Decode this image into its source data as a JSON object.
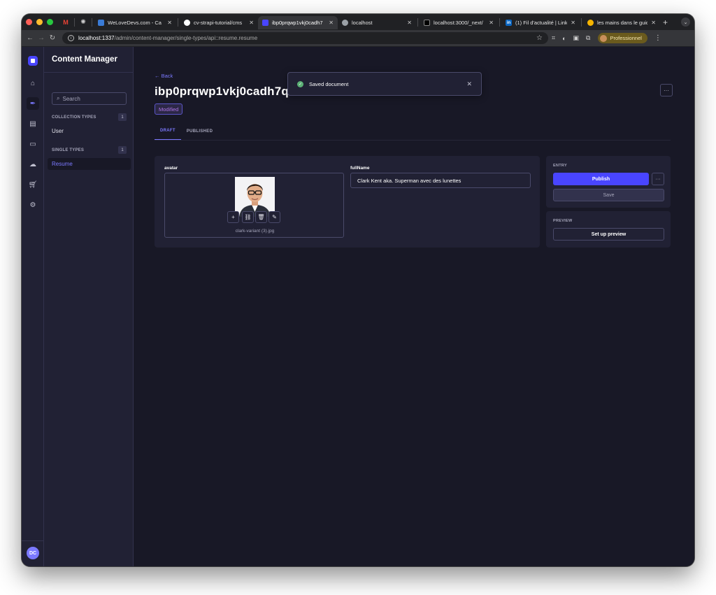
{
  "browser": {
    "tabs": [
      {
        "title": "WeLoveDevs.com - Ca",
        "favicon_color": "#3a7bd5",
        "active": false
      },
      {
        "title": "cv-strapi-tutorial/cms",
        "favicon_color": "#ffffff",
        "active": false
      },
      {
        "title": "ibp0prqwp1vkj0cadh7",
        "favicon_color": "#4945ff",
        "active": true
      },
      {
        "title": "localhost",
        "favicon_color": "#9aa0a6",
        "active": false
      },
      {
        "title": "localhost:3000/_next/",
        "favicon_color": "#000000",
        "active": false
      },
      {
        "title": "(1) Fil d'actualité | Link",
        "favicon_color": "#0a66c2",
        "active": false
      },
      {
        "title": "les mains dans le guid",
        "favicon_color": "#f5b400",
        "active": false
      }
    ],
    "url_host": "localhost:1337",
    "url_path": "/admin/content-manager/single-types/api::resume.resume",
    "profile_label": "Professionnel"
  },
  "sidebar": {
    "title": "Content Manager",
    "search_placeholder": "Search",
    "collection_types_label": "COLLECTION TYPES",
    "collection_types_count": "1",
    "collection_types": [
      "User"
    ],
    "single_types_label": "SINGLE TYPES",
    "single_types_count": "1",
    "single_types": [
      "Resume"
    ]
  },
  "rail": {
    "avatar_initials": "DC"
  },
  "header": {
    "back_label": "Back",
    "title": "ibp0prqwp1vkj0cadh7q",
    "status_badge": "Modified"
  },
  "tabs": {
    "draft": "DRAFT",
    "published": "PUBLISHED"
  },
  "form": {
    "avatar_label": "avatar",
    "avatar_filename": "clark-variant (3).jpg",
    "fullname_label": "fullName",
    "fullname_value": "Clark Kent aka. Superman avec des lunettes"
  },
  "entry_panel": {
    "label": "ENTRY",
    "publish_label": "Publish",
    "save_label": "Save"
  },
  "preview_panel": {
    "label": "PREVIEW",
    "setup_label": "Set up preview"
  },
  "toast": {
    "message": "Saved document"
  },
  "colors": {
    "primary": "#4945ff",
    "primary_text": "#7b79ff",
    "background": "#181826",
    "surface": "#212134",
    "border": "#4a4a6a",
    "modified_badge": "#ac73e6",
    "success": "#5cb176"
  }
}
